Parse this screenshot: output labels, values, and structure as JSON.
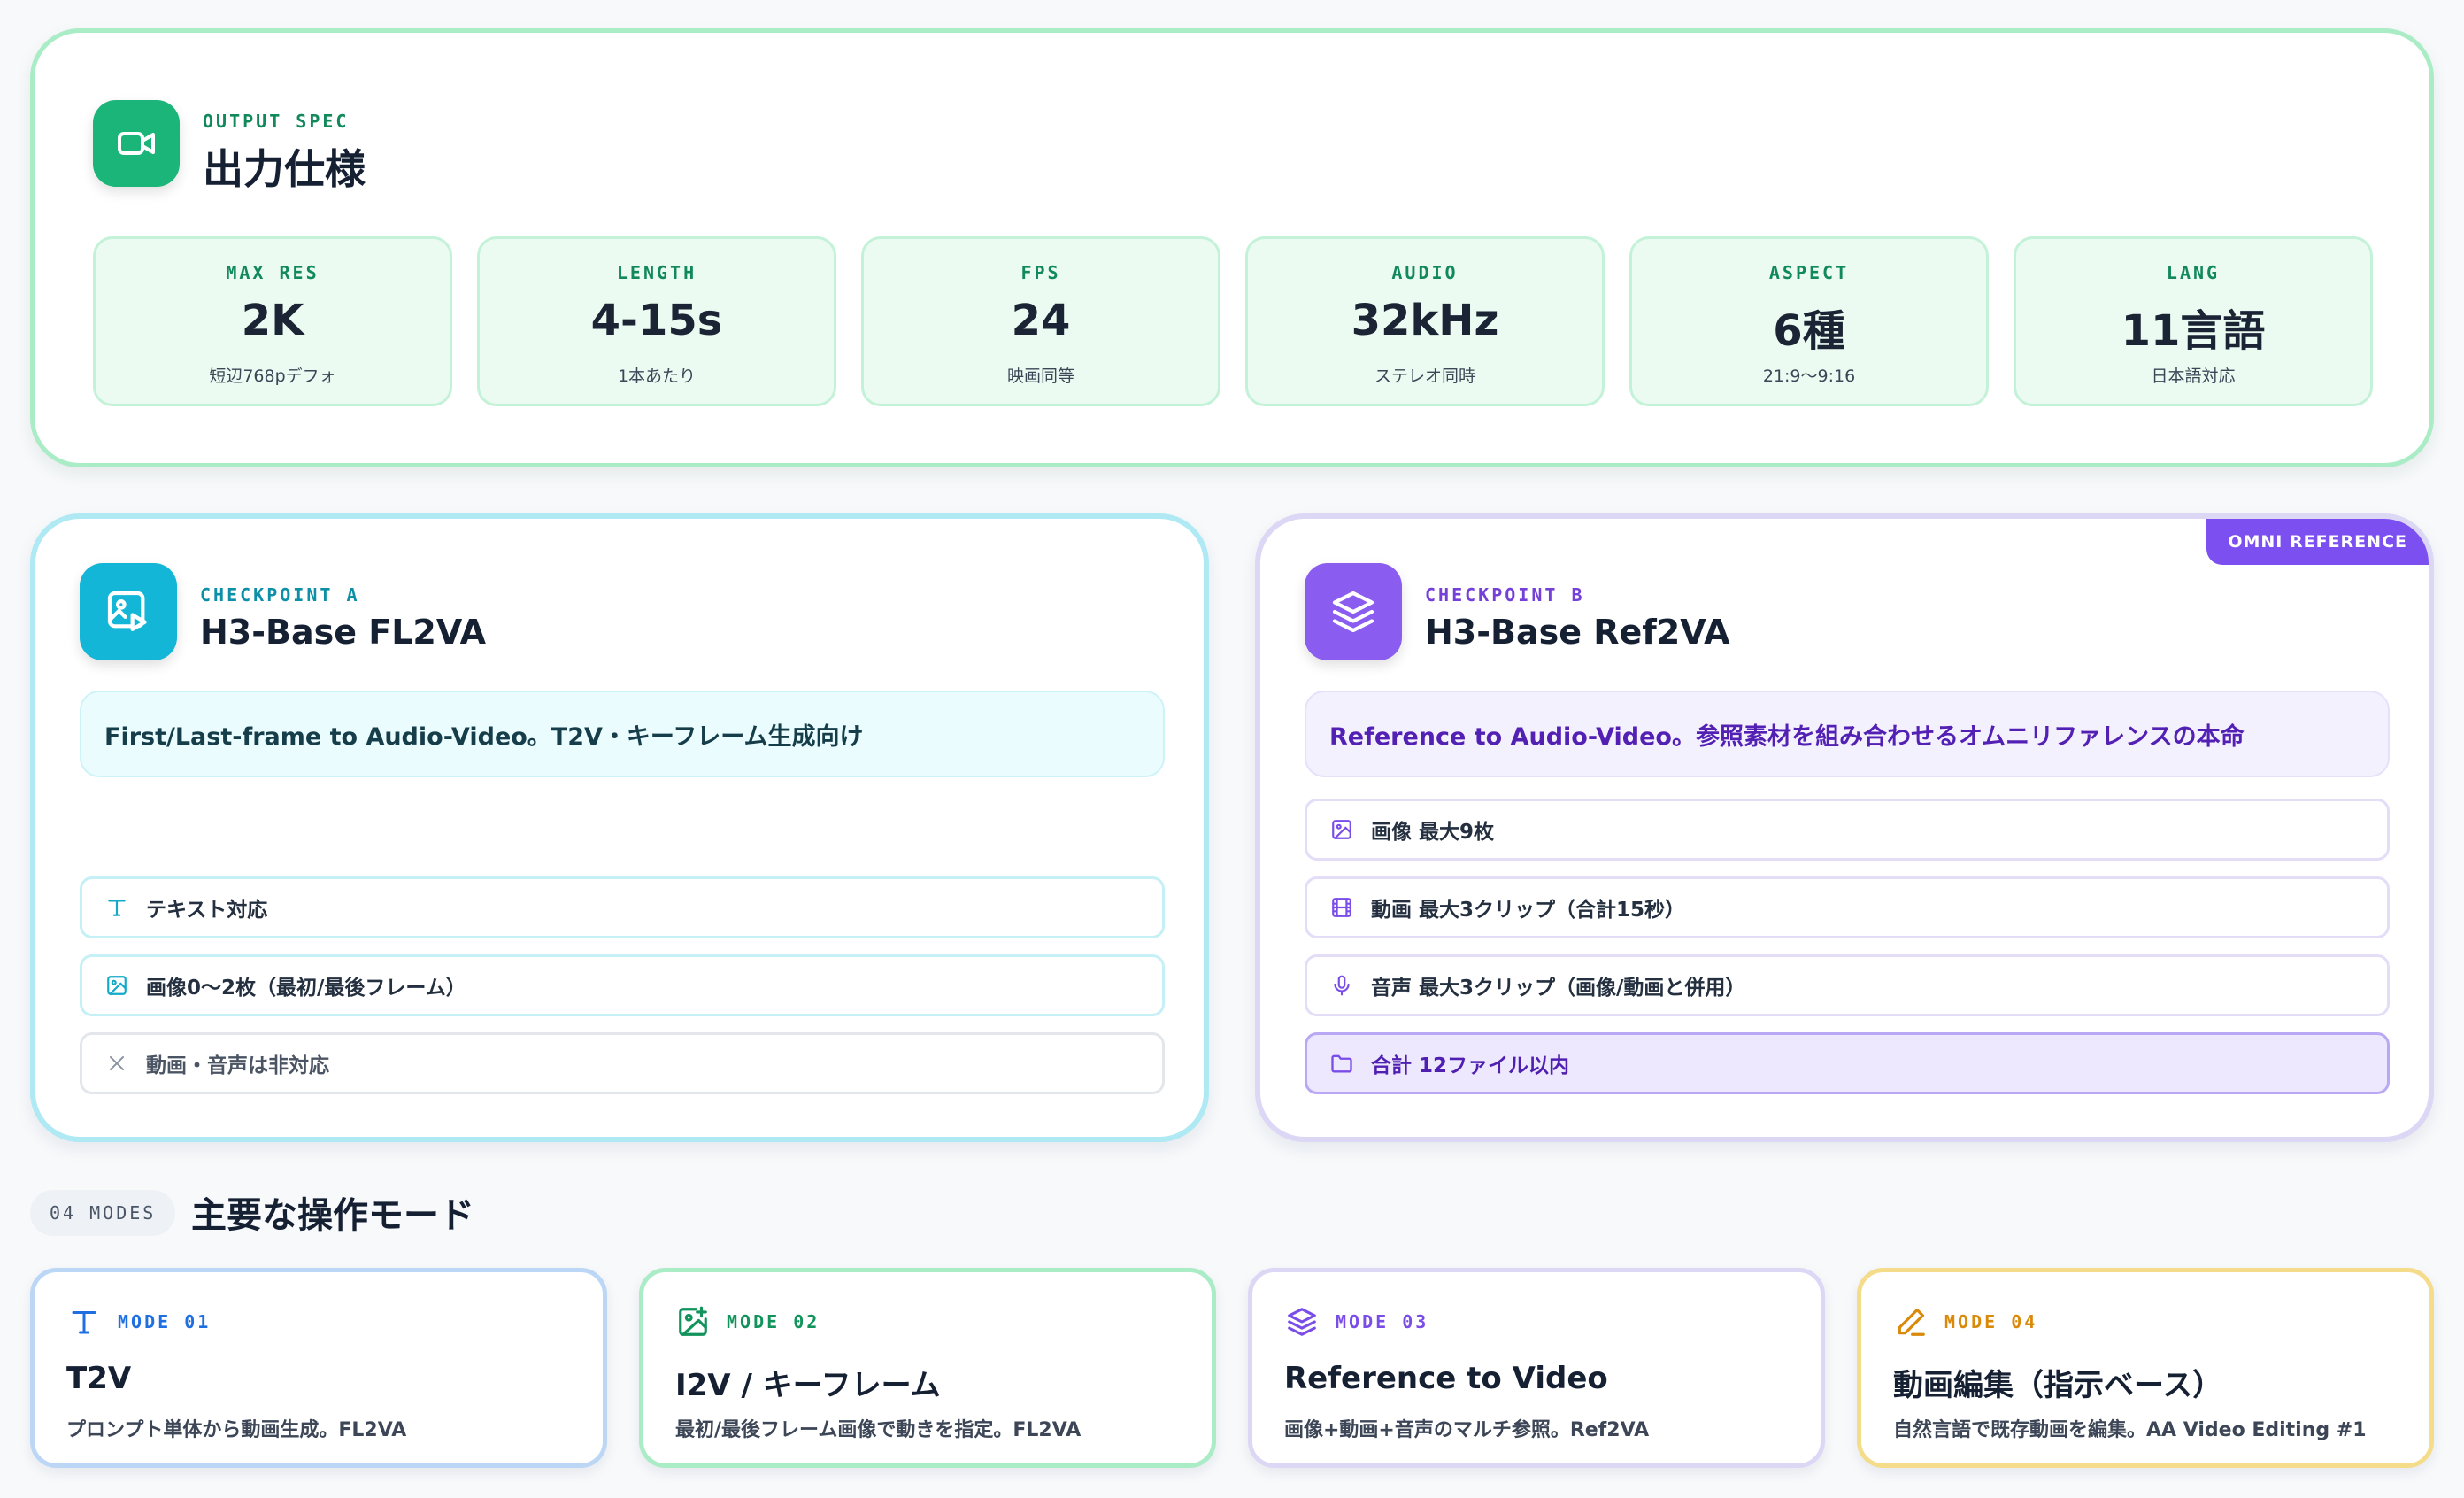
{
  "output_spec": {
    "eyebrow": "OUTPUT SPEC",
    "title": "出力仕様",
    "stats": [
      {
        "label": "MAX RES",
        "value": "2K",
        "sub": "短辺768pデフォ"
      },
      {
        "label": "LENGTH",
        "value": "4-15s",
        "sub": "1本あたり"
      },
      {
        "label": "FPS",
        "value": "24",
        "sub": "映画同等"
      },
      {
        "label": "AUDIO",
        "value": "32kHz",
        "sub": "ステレオ同時"
      },
      {
        "label": "ASPECT",
        "value": "6種",
        "sub": "21:9〜9:16"
      },
      {
        "label": "LANG",
        "value": "11言語",
        "sub": "日本語対応"
      }
    ]
  },
  "checkpoint_a": {
    "eyebrow": "CHECKPOINT A",
    "title": "H3-Base FL2VA",
    "description": "First/Last-frame to Audio-Video。T2V・キーフレーム生成向け",
    "features": [
      {
        "icon": "text-icon",
        "label": "テキスト対応"
      },
      {
        "icon": "image-icon",
        "label": "画像0〜2枚（最初/最後フレーム）"
      },
      {
        "icon": "close-icon",
        "label": "動画・音声は非対応"
      }
    ]
  },
  "checkpoint_b": {
    "badge": "OMNI REFERENCE",
    "eyebrow": "CHECKPOINT B",
    "title": "H3-Base Ref2VA",
    "description": "Reference to Audio-Video。参照素材を組み合わせるオムニリファレンスの本命",
    "features": [
      {
        "icon": "image-icon",
        "label": "画像 最大9枚"
      },
      {
        "icon": "film-icon",
        "label": "動画 最大3クリップ（合計15秒）"
      },
      {
        "icon": "microphone-icon",
        "label": "音声 最大3クリップ（画像/動画と併用）"
      },
      {
        "icon": "folder-icon",
        "label": "合計 12ファイル以内"
      }
    ]
  },
  "modes": {
    "count_label": "04 MODES",
    "title": "主要な操作モード",
    "items": [
      {
        "tag": "MODE 01",
        "icon": "text-icon",
        "title": "T2V",
        "desc": "プロンプト単体から動画生成。FL2VA",
        "color": "#1f6fe0"
      },
      {
        "tag": "MODE 02",
        "icon": "image-plus-icon",
        "title": "I2V / キーフレーム",
        "desc": "最初/最後フレーム画像で動きを指定。FL2VA",
        "color": "#12935c"
      },
      {
        "tag": "MODE 03",
        "icon": "layers-icon",
        "title": "Reference to Video",
        "desc": "画像+動画+音声のマルチ参照。Ref2VA",
        "color": "#7a4de8"
      },
      {
        "tag": "MODE 04",
        "icon": "pencil-icon",
        "title": "動画編集（指示ベース）",
        "desc": "自然言語で既存動画を編集。AA Video Editing #1",
        "color": "#d98a0b"
      }
    ]
  },
  "colors": {
    "green": "#1bb57a",
    "cyan": "#13b6d6",
    "purple": "#8a5cf0",
    "amber": "#f2d07a"
  }
}
